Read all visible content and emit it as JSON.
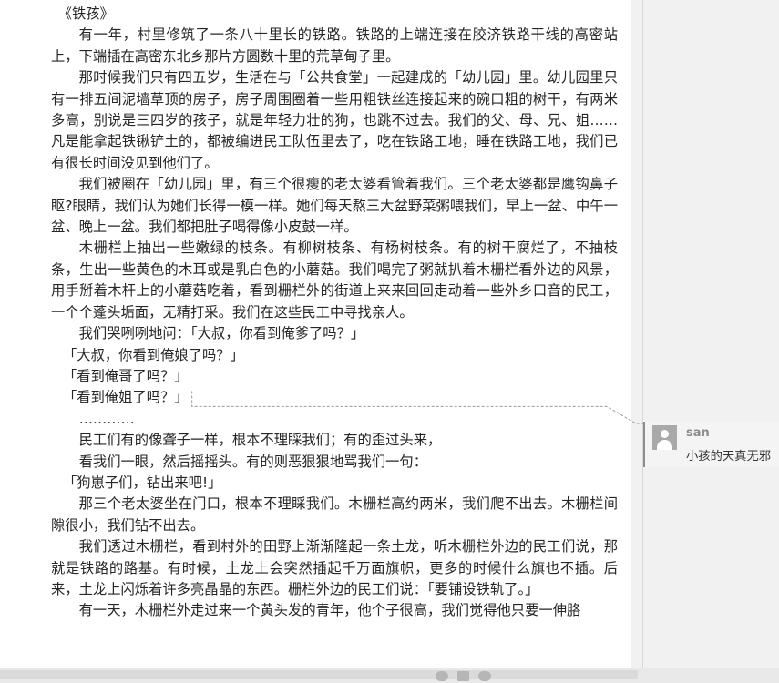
{
  "document": {
    "paragraphs": [
      {
        "style": "title",
        "text": "《铁孩》"
      },
      {
        "style": "body",
        "text": "有一年，村里修筑了一条八十里长的铁路。铁路的上端连接在胶济铁路干线的高密站上，下端插在高密东北乡那片方圆数十里的荒草甸子里。"
      },
      {
        "style": "body",
        "text": "那时候我们只有四五岁，生活在与「公共食堂」一起建成的「幼儿园」里。幼儿园里只有一排五间泥墙草顶的房子，房子周围圈着一些用粗铁丝连接起来的碗口粗的树干，有两米多高，别说是三四岁的孩子，就是年轻力壮的狗，也跳不过去。我们的父、母、兄、姐……凡是能拿起铁锹铲土的，都被编进民工队伍里去了，吃在铁路工地，睡在铁路工地，我们已有很长时间没见到他们了。"
      },
      {
        "style": "body",
        "text": "我们被圈在「幼儿园」里，有三个很瘦的老太婆看管着我们。三个老太婆都是鹰钩鼻子眍?眼睛，我们认为她们长得一模一样。她们每天熬三大盆野菜粥喂我们，早上一盆、中午一盆、晚上一盆。我们都把肚子喝得像小皮鼓一样。"
      },
      {
        "style": "body",
        "text": "木栅栏上抽出一些嫩绿的枝条。有柳树枝条、有杨树枝条。有的树干腐烂了，不抽枝条，生出一些黄色的木耳或是乳白色的小蘑菇。我们喝完了粥就扒着木栅栏看外边的风景，用手掰着木杆上的小蘑菇吃着，看到栅栏外的街道上来来回回走动着一些外乡口音的民工，一个个蓬头垢面，无精打采。我们在这些民工中寻找亲人。"
      },
      {
        "style": "body",
        "text": "我们哭咧咧地问：「大叔，你看到俺爹了吗？」"
      },
      {
        "style": "quote",
        "text": "「大叔，你看到俺娘了吗？」"
      },
      {
        "style": "quote",
        "text": "「看到俺哥了吗？」"
      },
      {
        "style": "quote",
        "text": "「看到俺姐了吗？」",
        "commented": true
      },
      {
        "style": "body",
        "text": "…………"
      },
      {
        "style": "body",
        "text": "民工们有的像聋子一样，根本不理睬我们；有的歪过头来，"
      },
      {
        "style": "body",
        "text": "看我们一眼，然后摇摇头。有的则恶狠狠地骂我们一句："
      },
      {
        "style": "quote",
        "text": "「狗崽子们，钻出来吧!」"
      },
      {
        "style": "body",
        "text": "那三个老太婆坐在门口，根本不理睬我们。木栅栏高约两米，我们爬不出去。木栅栏间隙很小，我们钻不出去。"
      },
      {
        "style": "body",
        "text": "我们透过木栅栏，看到村外的田野上渐渐隆起一条土龙，听木栅栏外边的民工们说，那就是铁路的路基。有时候，土龙上会突然插起千万面旗帜，更多的时候什么旗也不插。后来，土龙上闪烁着许多亮晶晶的东西。栅栏外边的民工们说：「要铺设铁轨了。」"
      },
      {
        "style": "body",
        "text": "有一天，木栅栏外走过来一个黄头发的青年，他个子很高，我们觉得他只要一伸胳"
      }
    ]
  },
  "comment": {
    "author": "san",
    "text": "小孩的天真无邪"
  },
  "icons": {
    "avatar": "user-avatar-icon"
  },
  "colors": {
    "page": "#ffffff",
    "pane": "#f1f1f1",
    "comment_bar": "#8c8c8c",
    "connector": "#9a9a9a"
  }
}
